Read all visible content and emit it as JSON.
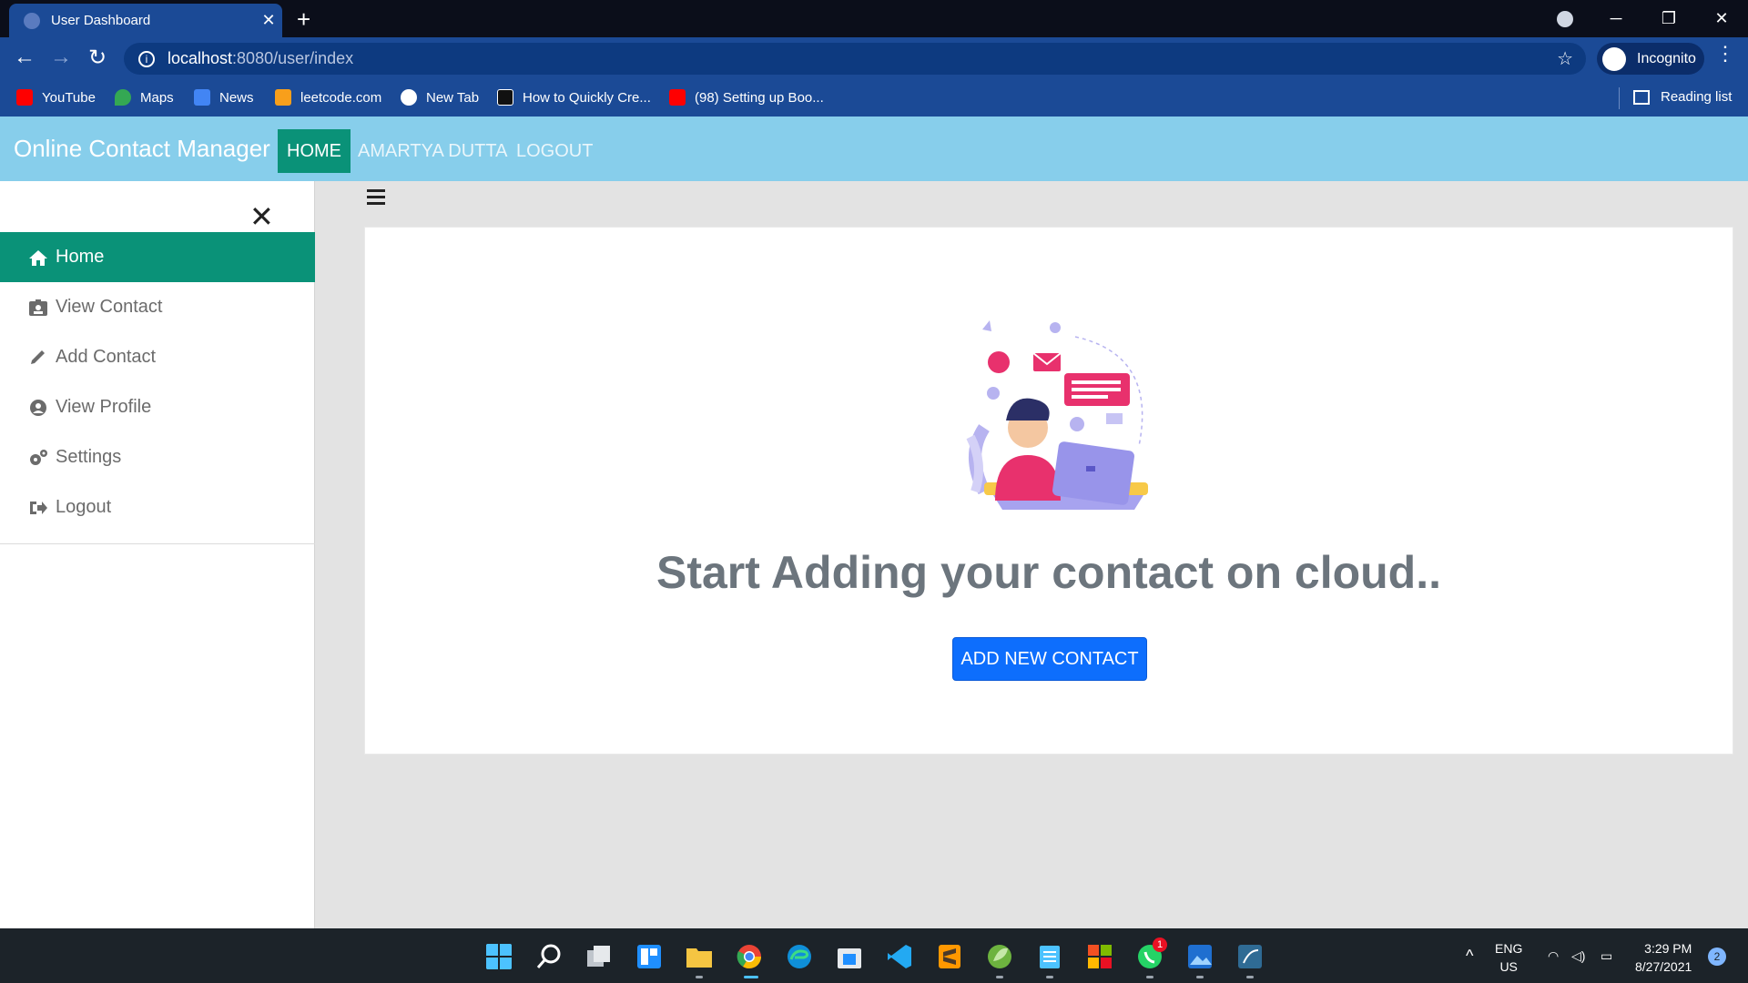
{
  "browser": {
    "tab_title": "User Dashboard",
    "url_host": "localhost",
    "url_path": ":8080/user/index",
    "profile_label": "Incognito",
    "bookmarks": [
      {
        "label": "YouTube",
        "icon": "youtube-icon",
        "color": "#ff0000"
      },
      {
        "label": "Maps",
        "icon": "maps-icon",
        "color": "#34a853"
      },
      {
        "label": "News",
        "icon": "news-icon",
        "color": "#4285f4"
      },
      {
        "label": "leetcode.com",
        "icon": "leetcode-icon",
        "color": "#f89f1b"
      },
      {
        "label": "New Tab",
        "icon": "globe-icon",
        "color": "#ffffff"
      },
      {
        "label": "How to Quickly Cre...",
        "icon": "htg-icon",
        "color": "#111111"
      },
      {
        "label": "(98) Setting up Boo...",
        "icon": "youtube-icon",
        "color": "#ff0000"
      }
    ],
    "reading_list": "Reading list"
  },
  "navbar": {
    "brand": "Online Contact Manager",
    "links": [
      "HOME",
      "AMARTYA DUTTA",
      "LOGOUT"
    ],
    "bg_color": "#87ceeb",
    "active_color": "#0a9278"
  },
  "sidebar": {
    "items": [
      {
        "label": "Home",
        "icon": "home-icon"
      },
      {
        "label": "View Contact",
        "icon": "contact-card-icon"
      },
      {
        "label": "Add Contact",
        "icon": "pencil-icon"
      },
      {
        "label": "View Profile",
        "icon": "user-circle-icon"
      },
      {
        "label": "Settings",
        "icon": "gears-icon"
      },
      {
        "label": "Logout",
        "icon": "sign-out-icon"
      }
    ]
  },
  "main": {
    "heading": "Start Adding your contact on cloud..",
    "button": "ADD NEW CONTACT",
    "button_color": "#0d6efd"
  },
  "taskbar": {
    "lang_top": "ENG",
    "lang_bottom": "US",
    "time": "3:29 PM",
    "date": "8/27/2021",
    "notification_count": "2",
    "whatsapp_badge": "1"
  }
}
